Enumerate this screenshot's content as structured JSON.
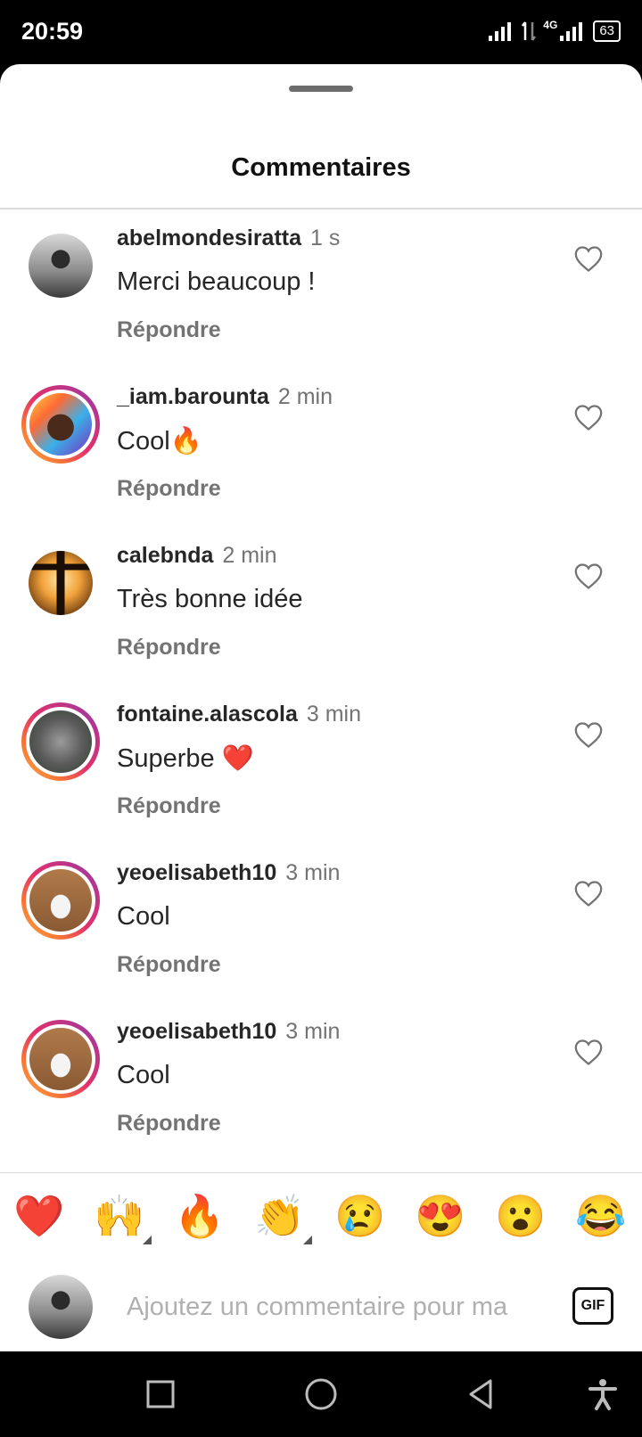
{
  "status_bar": {
    "time": "20:59",
    "network": "4G",
    "battery": "63"
  },
  "sheet": {
    "title": "Commentaires"
  },
  "comments": [
    {
      "user": "abelmondesiratta",
      "time": "1 s",
      "text": "Merci beaucoup !",
      "reply": "Répondre",
      "avatar": "photo",
      "story_ring": false
    },
    {
      "user": "_iam.barounta",
      "time": "2 min",
      "text": "Cool🔥",
      "reply": "Répondre",
      "avatar": "photo",
      "story_ring": true
    },
    {
      "user": "calebnda",
      "time": "2 min",
      "text": "Très bonne idée",
      "reply": "Répondre",
      "avatar": "photo",
      "story_ring": false
    },
    {
      "user": "fontaine.alascola",
      "time": "3 min",
      "text": "Superbe ❤️",
      "reply": "Répondre",
      "avatar": "photo",
      "story_ring": true
    },
    {
      "user": "yeoelisabeth10",
      "time": "3 min",
      "text": "Cool",
      "reply": "Répondre",
      "avatar": "photo",
      "story_ring": true
    },
    {
      "user": "yeoelisabeth10",
      "time": "3 min",
      "text": "Cool",
      "reply": "Répondre",
      "avatar": "photo",
      "story_ring": true
    }
  ],
  "reactions": [
    "❤️",
    "🙌",
    "🔥",
    "👏",
    "😢",
    "😍",
    "😮",
    "😂"
  ],
  "composer": {
    "placeholder": "Ajoutez un commentaire pour ma",
    "gif_label": "GIF"
  },
  "colors": {
    "accent_text": "#262626",
    "muted": "#737373",
    "heart": "#ed4956"
  },
  "icons": {
    "like": "heart-outline-icon",
    "nav": [
      "recents-square-icon",
      "home-circle-icon",
      "back-triangle-icon",
      "accessibility-icon"
    ]
  }
}
